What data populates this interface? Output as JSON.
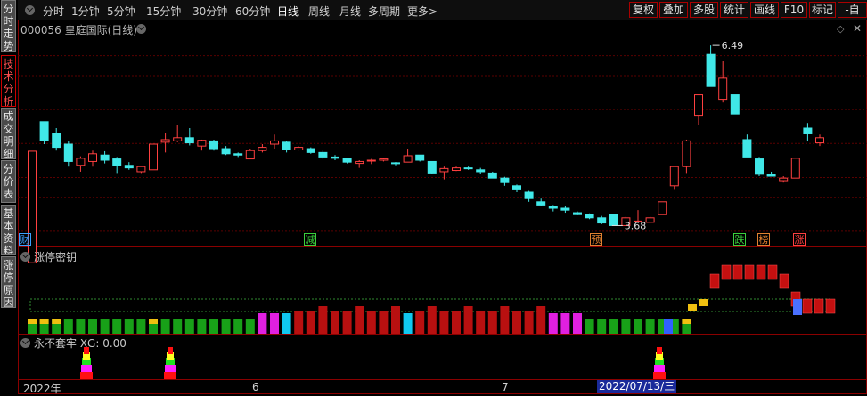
{
  "left_tabs": [
    {
      "label": "分时走势"
    },
    {
      "label": "技术分析"
    },
    {
      "label": "成交明细"
    },
    {
      "label": "分价表"
    },
    {
      "label": "基本资料"
    },
    {
      "label": "涨停原因"
    }
  ],
  "toolbar": {
    "periods": [
      "分时",
      "1分钟",
      "5分钟",
      "15分钟",
      "30分钟",
      "60分钟",
      "日线",
      "周线",
      "月线",
      "多周期",
      "更多>"
    ],
    "active_period": "日线",
    "right_buttons": [
      "复权",
      "叠加",
      "多股",
      "统计",
      "画线",
      "F10",
      "标记",
      "-自"
    ]
  },
  "main_chart": {
    "title": "000056 皇庭国际(日线)",
    "high_label": "6.49",
    "low_label": "3.68"
  },
  "markers": [
    {
      "text": "财",
      "color": "#3aa0ff"
    },
    {
      "text": "减",
      "color": "#3cd03c"
    },
    {
      "text": "预",
      "color": "#e08030"
    },
    {
      "text": "跌",
      "color": "#3cd03c"
    },
    {
      "text": "榜",
      "color": "#e08030"
    },
    {
      "text": "涨",
      "color": "#ff4040"
    }
  ],
  "panel2": {
    "title": "涨停密钥"
  },
  "panel3": {
    "title": "永不套牢 XG: 0.00"
  },
  "xaxis": {
    "labels": [
      "2022年",
      "6",
      "7"
    ],
    "cursor_date": "2022/07/13/三"
  },
  "colors": {
    "up": "#ff4040",
    "down": "#40e8e8",
    "grid": "#5a0000",
    "border": "#8a0000"
  },
  "chart_data": {
    "type": "candlestick",
    "candles": [
      [
        3.1,
        4.84,
        3.1,
        4.84
      ],
      [
        5.3,
        5.0,
        5.3,
        4.95
      ],
      [
        5.12,
        4.9,
        5.2,
        4.85
      ],
      [
        4.95,
        4.68,
        5.0,
        4.6
      ],
      [
        4.62,
        4.73,
        4.76,
        4.52
      ],
      [
        4.68,
        4.8,
        4.85,
        4.6
      ],
      [
        4.78,
        4.7,
        4.84,
        4.65
      ],
      [
        4.72,
        4.62,
        4.75,
        4.5
      ],
      [
        4.62,
        4.58,
        4.67,
        4.55
      ],
      [
        4.52,
        4.6,
        4.6,
        4.5
      ],
      [
        4.55,
        4.95,
        4.95,
        4.55
      ],
      [
        4.98,
        5.02,
        5.12,
        4.82
      ],
      [
        5.0,
        5.05,
        5.25,
        4.98
      ],
      [
        5.05,
        4.97,
        5.2,
        4.93
      ],
      [
        4.92,
        5.01,
        5.02,
        4.85
      ],
      [
        5.0,
        4.88,
        5.02,
        4.85
      ],
      [
        4.88,
        4.8,
        4.92,
        4.78
      ],
      [
        4.8,
        4.78,
        4.82,
        4.75
      ],
      [
        4.72,
        4.85,
        4.88,
        4.72
      ],
      [
        4.85,
        4.9,
        4.95,
        4.82
      ],
      [
        4.95,
        5.0,
        5.1,
        4.88
      ],
      [
        4.98,
        4.87,
        5.0,
        4.82
      ],
      [
        4.86,
        4.9,
        4.92,
        4.85
      ],
      [
        4.88,
        4.82,
        4.9,
        4.8
      ],
      [
        4.82,
        4.75,
        4.85,
        4.72
      ],
      [
        4.75,
        4.73,
        4.78,
        4.7
      ],
      [
        4.73,
        4.67,
        4.74,
        4.65
      ],
      [
        4.65,
        4.68,
        4.7,
        4.58
      ],
      [
        4.7,
        4.7,
        4.72,
        4.64
      ],
      [
        4.7,
        4.72,
        4.74,
        4.68
      ],
      [
        4.66,
        4.65,
        4.67,
        4.62
      ],
      [
        4.67,
        4.77,
        4.88,
        4.67
      ],
      [
        4.78,
        4.7,
        4.75,
        4.68
      ],
      [
        4.68,
        4.5,
        4.68,
        4.48
      ],
      [
        4.52,
        4.57,
        4.6,
        4.4
      ],
      [
        4.54,
        4.58,
        4.6,
        4.53
      ],
      [
        4.58,
        4.57,
        4.6,
        4.55
      ],
      [
        4.55,
        4.52,
        4.58,
        4.48
      ],
      [
        4.5,
        4.42,
        4.52,
        4.42
      ],
      [
        4.42,
        4.35,
        4.44,
        4.3
      ],
      [
        4.3,
        4.25,
        4.32,
        4.2
      ],
      [
        4.2,
        4.1,
        4.22,
        4.05
      ],
      [
        4.05,
        4.0,
        4.1,
        3.98
      ],
      [
        3.98,
        3.95,
        4.0,
        3.9
      ],
      [
        3.95,
        3.92,
        3.98,
        3.88
      ],
      [
        3.88,
        3.85,
        3.9,
        3.84
      ],
      [
        3.85,
        3.8,
        3.87,
        3.78
      ],
      [
        3.8,
        3.72,
        3.83,
        3.7
      ],
      [
        3.85,
        3.68,
        3.85,
        3.68
      ],
      [
        3.68,
        3.8,
        3.82,
        3.72
      ],
      [
        3.75,
        3.75,
        3.92,
        3.72
      ],
      [
        3.73,
        3.8,
        3.82,
        3.73
      ],
      [
        3.85,
        4.05,
        4.05,
        3.85
      ],
      [
        4.3,
        4.6,
        4.6,
        4.25
      ],
      [
        4.6,
        5.0,
        5.02,
        4.5
      ],
      [
        5.4,
        5.72,
        5.72,
        5.25
      ],
      [
        6.35,
        5.85,
        6.49,
        5.85
      ],
      [
        5.65,
        5.98,
        6.25,
        5.6
      ],
      [
        5.72,
        5.42,
        5.72,
        5.45
      ],
      [
        5.02,
        4.75,
        5.1,
        4.75
      ],
      [
        4.72,
        4.48,
        4.75,
        4.45
      ],
      [
        4.48,
        4.45,
        4.52,
        4.45
      ],
      [
        4.38,
        4.42,
        4.45,
        4.35
      ],
      [
        4.42,
        4.73,
        4.73,
        4.42
      ],
      [
        5.2,
        5.11,
        5.28,
        5.0
      ],
      [
        4.97,
        5.05,
        5.1,
        4.92
      ]
    ],
    "ylim": [
      3.45,
      6.7
    ],
    "gridlines": [
      6.33,
      6.02,
      5.49,
      4.96,
      4.43,
      4.12,
      3.59
    ],
    "high": 6.49,
    "low": 3.68
  }
}
